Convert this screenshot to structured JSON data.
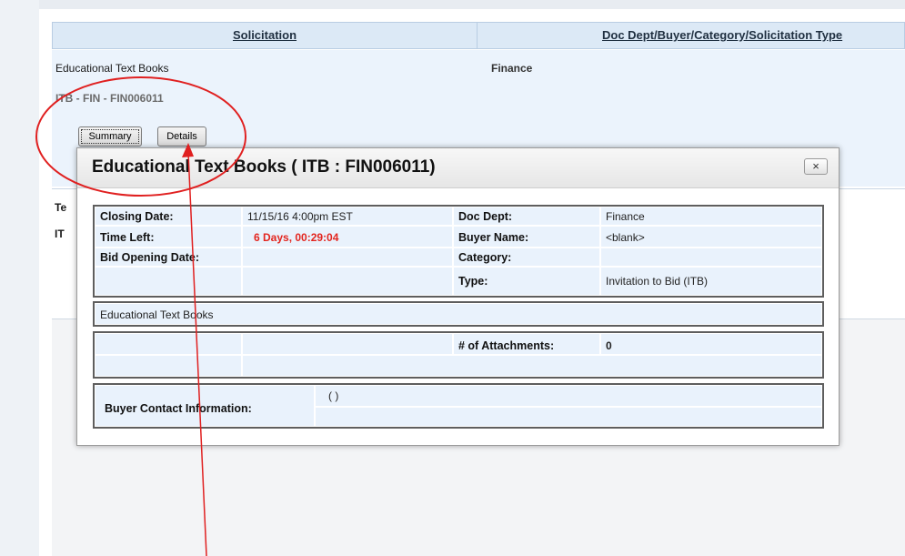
{
  "table": {
    "columns": [
      "Solicitation",
      "Doc Dept/Buyer/Category/Solicitation Type"
    ],
    "row": {
      "title": "Educational Text Books",
      "id": "ITB -  FIN -  FIN006011",
      "dept": "Finance",
      "summary_button": "Summary",
      "details_button": "Details"
    },
    "row2_fragments": [
      "Te",
      "IT"
    ]
  },
  "modal": {
    "title": "Educational Text Books ( ITB :  FIN006011)",
    "close_label": "×",
    "info": {
      "closing_date_label": "Closing Date:",
      "closing_date_value": "11/15/16 4:00pm EST",
      "time_left_label": "Time Left:",
      "time_left_value": "6 Days, 00:29:04",
      "bid_opening_label": "Bid Opening Date:",
      "doc_dept_label": "Doc Dept:",
      "doc_dept_value": "Finance",
      "buyer_name_label": "Buyer Name:",
      "buyer_name_value": "<blank>",
      "category_label": "Category:",
      "type_label": "Type:",
      "type_value": "Invitation to Bid (ITB)"
    },
    "description": "Educational Text Books",
    "attachments_label": "# of Attachments:",
    "attachments_value": "0",
    "buyer_contact_label": "Buyer Contact Information:",
    "buyer_contact_value": "( )"
  },
  "colors": {
    "annotation": "#e02020",
    "time_left": "#e3261f",
    "header_bg": "#dce9f6",
    "cell_bg": "#e9f2fc"
  }
}
